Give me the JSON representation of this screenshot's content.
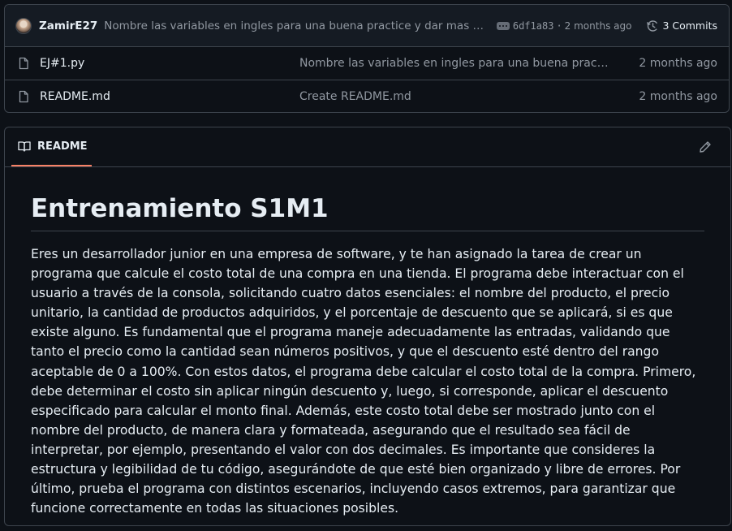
{
  "latest_commit": {
    "author": "ZamirE27",
    "message": "Nombre las variables en ingles para una buena practice y dar mas claridad",
    "sha": "6df1a83",
    "separator": "·",
    "date": "2 months ago",
    "commits_label": "3 Commits"
  },
  "files": [
    {
      "name": "EJ#1.py",
      "commit_message": "Nombre las variables en ingles para una buena practice y dar mas claridad",
      "date": "2 months ago"
    },
    {
      "name": "README.md",
      "commit_message": "Create README.md",
      "date": "2 months ago"
    }
  ],
  "readme": {
    "tab_label": "README",
    "title": "Entrenamiento S1M1",
    "body": "Eres un desarrollador junior en una empresa de software, y te han asignado la tarea de crear un programa que calcule el costo total de una compra en una tienda. El programa debe interactuar con el usuario a través de la consola, solicitando cuatro datos esenciales: el nombre del producto, el precio unitario, la cantidad de productos adquiridos, y el porcentaje de descuento que se aplicará, si es que existe alguno. Es fundamental que el programa maneje adecuadamente las entradas, validando que tanto el precio como la cantidad sean números positivos, y que el descuento esté dentro del rango aceptable de 0 a 100%. Con estos datos, el programa debe calcular el costo total de la compra. Primero, debe determinar el costo sin aplicar ningún descuento y, luego, si corresponde, aplicar el descuento especificado para calcular el monto final. Además, este costo total debe ser mostrado junto con el nombre del producto, de manera clara y formateada, asegurando que el resultado sea fácil de interpretar, por ejemplo, presentando el valor con dos decimales. Es importante que consideres la estructura y legibilidad de tu código, asegurándote de que esté bien organizado y libre de errores. Por último, prueba el programa con distintos escenarios, incluyendo casos extremos, para garantizar que funcione correctamente en todas las situaciones posibles."
  },
  "colors": {
    "background": "#0d1117",
    "border": "#3d444d",
    "muted_text": "#9198a1",
    "accent_underline": "#f78166"
  },
  "icons": [
    "avatar",
    "ellipsis-icon",
    "history-icon",
    "file-icon",
    "book-icon",
    "pencil-icon"
  ]
}
